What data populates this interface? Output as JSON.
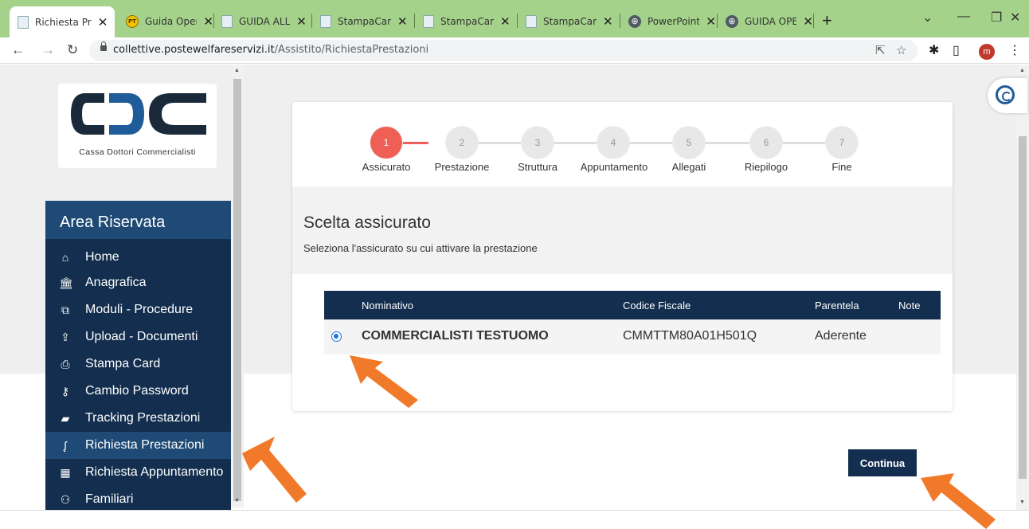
{
  "browser": {
    "tabs": [
      {
        "title": "Richiesta Pr",
        "icon": "doc-icon",
        "active": true
      },
      {
        "title": "Guida Oper",
        "icon": "pt-icon",
        "active": false
      },
      {
        "title": "GUIDA ALL",
        "icon": "doc-icon",
        "active": false
      },
      {
        "title": "StampaCar",
        "icon": "doc-icon",
        "active": false
      },
      {
        "title": "StampaCar",
        "icon": "doc-icon",
        "active": false
      },
      {
        "title": "StampaCar",
        "icon": "doc-icon",
        "active": false
      },
      {
        "title": "PowerPoint",
        "icon": "globe-icon",
        "active": false
      },
      {
        "title": "GUIDA OPE",
        "icon": "globe-icon",
        "active": false
      }
    ],
    "url_host": "collettive.postewelfareservizi.it",
    "url_path": "/Assistito/RichiestaPrestazioni",
    "profile_initial": "m"
  },
  "logo": {
    "caption": "Cassa Dottori Commercialisti",
    "color": "#1a2a3a",
    "accent": "#1f5c99"
  },
  "sidebar": {
    "title": "Area Riservata",
    "items": [
      {
        "label": "Home",
        "icon": "home-icon",
        "active": false
      },
      {
        "label": "Anagrafica",
        "icon": "bank-icon",
        "active": false
      },
      {
        "label": "Moduli - Procedure",
        "icon": "copy-icon",
        "active": false
      },
      {
        "label": "Upload - Documenti",
        "icon": "upload-icon",
        "active": false
      },
      {
        "label": "Stampa Card",
        "icon": "print-icon",
        "active": false
      },
      {
        "label": "Cambio Password",
        "icon": "key-icon",
        "active": false
      },
      {
        "label": "Tracking Prestazioni",
        "icon": "book-icon",
        "active": false
      },
      {
        "label": "Richiesta Prestazioni",
        "icon": "stethoscope-icon",
        "active": true
      },
      {
        "label": "Richiesta Appuntamento",
        "icon": "calendar-icon",
        "active": false
      },
      {
        "label": "Familiari",
        "icon": "users-icon",
        "active": false
      }
    ]
  },
  "wizard": {
    "steps": [
      {
        "num": "1",
        "label": "Assicurato",
        "active": true
      },
      {
        "num": "2",
        "label": "Prestazione",
        "active": false
      },
      {
        "num": "3",
        "label": "Struttura",
        "active": false
      },
      {
        "num": "4",
        "label": "Appuntamento",
        "active": false
      },
      {
        "num": "5",
        "label": "Allegati",
        "active": false
      },
      {
        "num": "6",
        "label": "Riepilogo",
        "active": false
      },
      {
        "num": "7",
        "label": "Fine",
        "active": false
      }
    ],
    "section_title": "Scelta assicurato",
    "section_subtitle": "Seleziona l'assicurato su cui attivare la prestazione",
    "table": {
      "headers": [
        "Nominativo",
        "Codice Fiscale",
        "Parentela",
        "Note"
      ],
      "rows": [
        {
          "selected": true,
          "nominativo": "COMMERCIALISTI TESTUOMO",
          "codice_fiscale": "CMMTTM80A01H501Q",
          "parentela": "Aderente",
          "note": ""
        }
      ]
    }
  },
  "continue_label": "Continua",
  "colors": {
    "navy": "#132e4e",
    "step_active": "#ef5f56",
    "arrow": "#f07a2a"
  }
}
